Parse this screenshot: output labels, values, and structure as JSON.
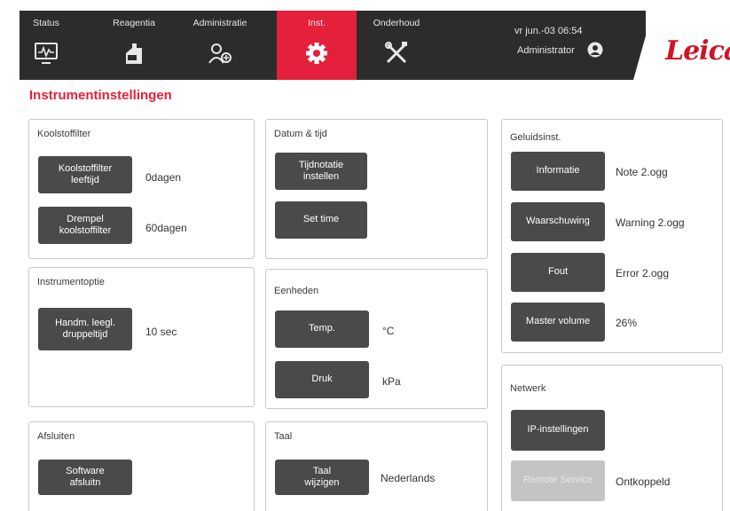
{
  "header": {
    "tabs": [
      {
        "label": "Status",
        "icon": "monitor-chart-icon"
      },
      {
        "label": "Reagentia",
        "icon": "reagent-bottle-icon"
      },
      {
        "label": "Administratie",
        "icon": "admin-users-icon"
      },
      {
        "label": "Inst.",
        "icon": "gear-icon",
        "active": true
      },
      {
        "label": "Onderhoud",
        "icon": "tools-icon"
      }
    ],
    "datetime": "vr jun.-03 06:54",
    "user": "Administrator",
    "logo": "Leica",
    "active_color": "#e5203a",
    "bar_color": "#2c2c2c"
  },
  "page_title": "Instrumentinstellingen",
  "koolstoffilter": {
    "title": "Koolstoffilter",
    "lifetime_button": "Koolstoffilter\nleeftijd",
    "lifetime_value": "0dagen",
    "threshold_button": "Drempel\nkoolstoffilter",
    "threshold_value": "60dagen"
  },
  "instrumentoptie": {
    "title": "Instrumentoptie",
    "drip_button": "Handm. leegl.\ndruppeltijd",
    "drip_value": "10 sec"
  },
  "afsluiten": {
    "title": "Afsluiten",
    "shutdown_button": "Software\nafsluitn"
  },
  "datum": {
    "title": "Datum & tijd",
    "notation_button": "Tijdnotatie\ninstellen",
    "settime_button": "Set time"
  },
  "eenheden": {
    "title": "Eenheden",
    "temp_button": "Temp.",
    "temp_value": "°C",
    "druk_button": "Druk",
    "druk_value": "kPa"
  },
  "taal": {
    "title": "Taal",
    "change_button": "Taal\nwijzigen",
    "value": "Nederlands"
  },
  "geluid": {
    "title": "Geluidsinst.",
    "info_button": "Informatie",
    "info_value": "Note 2.ogg",
    "warn_button": "Waarschuwing",
    "warn_value": "Warning 2.ogg",
    "error_button": "Fout",
    "error_value": "Error 2.ogg",
    "master_button": "Master volume",
    "master_value": "26%"
  },
  "netwerk": {
    "title": "Netwerk",
    "ip_button": "IP-instellingen",
    "remote_button": "Remote Service",
    "remote_value": "Ontkoppeld"
  }
}
